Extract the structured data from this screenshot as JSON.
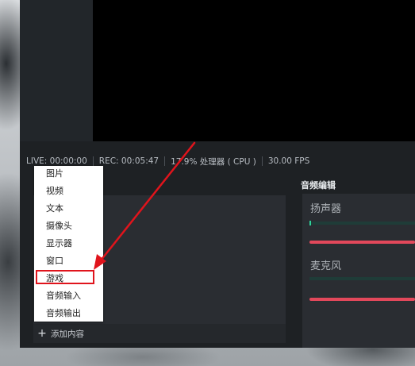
{
  "status_bar": {
    "live": "LIVE: 00:00:00",
    "rec": "REC: 00:05:47",
    "cpu": "17.9% 处理器 ( CPU )",
    "fps": "30.00 FPS"
  },
  "audio_mixer": {
    "title": "音频编辑",
    "channels": [
      {
        "label": "扬声器"
      },
      {
        "label": "麦克风"
      }
    ],
    "meter_color": "#2fd39a",
    "slider_color": "#e2485b"
  },
  "sources": {
    "add_label": "添加内容"
  },
  "context_menu": {
    "items": [
      "图片",
      "视频",
      "文本",
      "摄像头",
      "显示器",
      "窗口",
      "游戏",
      "音频输入",
      "音频输出"
    ],
    "highlighted_item": "游戏",
    "highlight_color": "#e0141c"
  }
}
